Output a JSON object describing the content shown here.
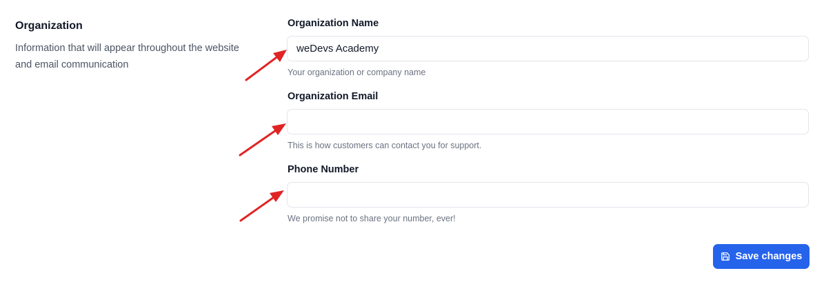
{
  "section": {
    "title": "Organization",
    "description": "Information that will appear throughout the website and email communication"
  },
  "fields": [
    {
      "label": "Organization Name",
      "value": "weDevs Academy",
      "placeholder": "",
      "help": "Your organization or company name"
    },
    {
      "label": "Organization Email",
      "value": "",
      "placeholder": "",
      "help": "This is how customers can contact you for support."
    },
    {
      "label": "Phone Number",
      "value": "",
      "placeholder": "",
      "help": "We promise not to share your number, ever!"
    }
  ],
  "actions": {
    "save_label": "Save changes",
    "save_icon": "floppy-disk-icon"
  },
  "colors": {
    "primary": "#2563eb",
    "annotation_arrow": "#e02424",
    "text_primary": "#111827",
    "text_secondary": "#4b5563",
    "text_muted": "#6b7280",
    "input_border": "#e2e5ea"
  }
}
